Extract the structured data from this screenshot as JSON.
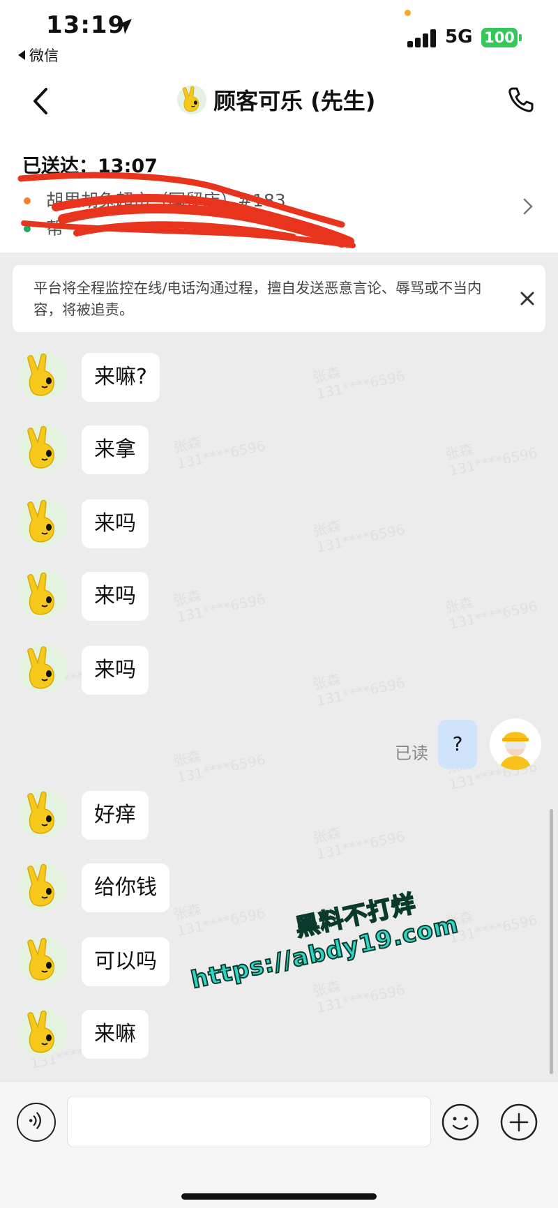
{
  "status_bar": {
    "time": "13:19",
    "back_app": "微信",
    "network": "5G",
    "battery": "100"
  },
  "nav": {
    "title": "顾客可乐 (先生)",
    "back_icon": "chevron-left-icon",
    "call_icon": "phone-icon"
  },
  "order": {
    "sent_label": "已送达：13:07",
    "store": "胡里胡兔超市（国贸店）#183",
    "customer_addr": "帮",
    "colors": {
      "store_dot": "#f5822a",
      "addr_dot": "#1aad5b",
      "scribble": "#e8341c"
    }
  },
  "notice": {
    "text": "平台将全程监控在线/电话沟通过程，擅自发送恶意言论、辱骂或不当内容，将被追责。",
    "close_icon": "close-icon"
  },
  "chat": {
    "messages": [
      {
        "from": "customer",
        "text": "来嘛?"
      },
      {
        "from": "customer",
        "text": "来拿"
      },
      {
        "from": "customer",
        "text": "来吗"
      },
      {
        "from": "customer",
        "text": "来吗"
      },
      {
        "from": "customer",
        "text": "来吗"
      },
      {
        "from": "rider",
        "text": "?",
        "status": "已读"
      },
      {
        "from": "customer",
        "text": "好痒"
      },
      {
        "from": "customer",
        "text": "给你钱"
      },
      {
        "from": "customer",
        "text": "可以吗"
      },
      {
        "from": "customer",
        "text": "来嘛"
      }
    ],
    "watermark": {
      "line1": "张森",
      "line2": "131****6596"
    }
  },
  "overlay": {
    "line1": "黑料不打烊",
    "line2": "https://abdy19.com"
  },
  "input_bar": {
    "value": "",
    "voice_icon": "voice-icon",
    "emoji_icon": "emoji-icon",
    "plus_icon": "plus-icon"
  }
}
